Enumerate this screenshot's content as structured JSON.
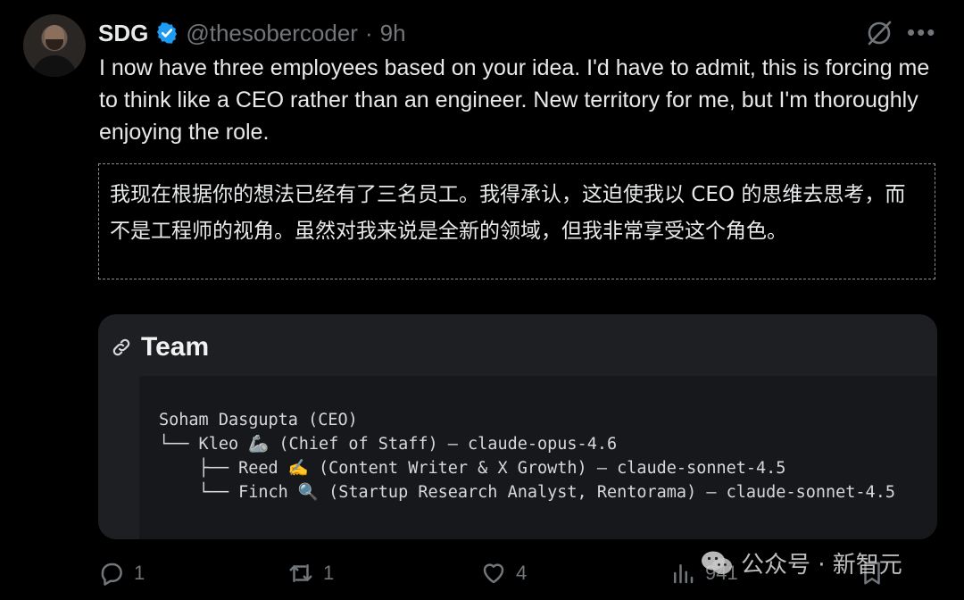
{
  "tweet": {
    "author_name": "SDG",
    "handle": "@thesobercoder",
    "separator": "·",
    "time": "9h",
    "text": "I now have three employees based on your idea. I'd have to admit, this is forcing me to think like a CEO rather than an engineer. New territory for me, but I'm thoroughly enjoying the role.",
    "translation": "我现在根据你的想法已经有了三名员工。我得承认，这迫使我以 CEO 的思维去思考，而不是工程师的视角。虽然对我来说是全新的领域，但我非常享受这个角色。"
  },
  "card": {
    "title": "Team",
    "lines": [
      "Soham Dasgupta (CEO)",
      "└── Kleo 🦾 (Chief of Staff) — claude-opus-4.6",
      "    ├── Reed ✍️ (Content Writer & X Growth) — claude-sonnet-4.5",
      "    └── Finch 🔍 (Startup Research Analyst, Rentorama) — claude-sonnet-4.5"
    ]
  },
  "actions": {
    "replies": "1",
    "reposts": "1",
    "likes": "4",
    "views": "941"
  },
  "watermark": {
    "text": "公众号 · 新智元"
  },
  "icons": [
    "verified-badge-icon",
    "grok-icon",
    "more-icon",
    "link-icon",
    "reply-icon",
    "repost-icon",
    "like-icon",
    "views-icon",
    "bookmark-icon",
    "wechat-icon"
  ],
  "colors": {
    "background": "#000000",
    "text": "#e7e9ea",
    "muted": "#71767b",
    "verified": "#1d9bf0",
    "card": "#1d1f23"
  }
}
